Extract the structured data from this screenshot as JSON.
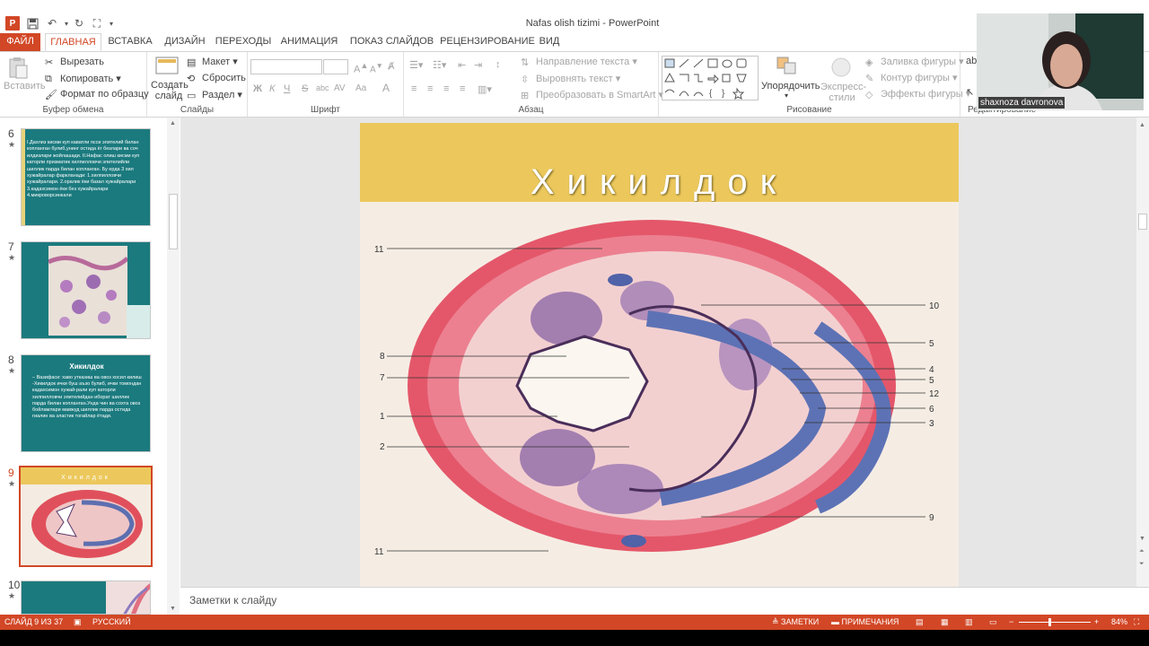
{
  "window": {
    "title": "Nafas olish tizimi - PowerPoint"
  },
  "tabs": [
    "ФАЙЛ",
    "ГЛАВНАЯ",
    "ВСТАВКА",
    "ДИЗАЙН",
    "ПЕРЕХОДЫ",
    "АНИМАЦИЯ",
    "ПОКАЗ СЛАЙДОВ",
    "РЕЦЕНЗИРОВАНИЕ",
    "ВИД"
  ],
  "ribbon": {
    "clipboard": {
      "paste": "Вставить",
      "cut": "Вырезать",
      "copy": "Копировать",
      "format_painter": "Формат по образцу",
      "label": "Буфер обмена"
    },
    "slides": {
      "new_slide": "Создать слайд",
      "layout": "Макет",
      "reset": "Сбросить",
      "section": "Раздел",
      "label": "Слайды"
    },
    "font": {
      "label": "Шрифт",
      "bold": "Ж",
      "italic": "К",
      "underline": "Ч",
      "strike": "S",
      "shadow": "abc",
      "spacing": "AV",
      "case": "Aa",
      "color": "A"
    },
    "paragraph": {
      "text_direction": "Направление текста",
      "align_text": "Выровнять текст",
      "smartart": "Преобразовать в SmartArt",
      "label": "Абзац"
    },
    "drawing": {
      "arrange": "Упорядочить",
      "quick_styles": "Экспресс-стили",
      "fill": "Заливка фигуры",
      "outline": "Контур фигуры",
      "effects": "Эффекты фигуры",
      "label": "Рисование"
    },
    "editing": {
      "label": "Редактирование"
    }
  },
  "thumbnails": [
    {
      "num": "6",
      "text": "I.Дахлиз кисми куп каватли ясси эпителий билан копланган булиб,унинг остида ёг безлари ва соч илдизлари жойлашади. II.Нафас олиш кисми куп каторли призматик хилпилловчи эпителийли шиллик парда билан копланган. Бу ерда 3 хил хужайралар фаркланади: 1.хилпилловчи хужайралари. 2.оралик ёки базал хужайралари 3.кадахсимон ёки без хужайралари 4.микроворсинкали"
    },
    {
      "num": "7",
      "text": ""
    },
    {
      "num": "8",
      "title": "Хикилдок",
      "text": "– Вазифаси: хаво утказиш ва овоз хосил килиш -Хикилдок ички буш аъзо булиб, ички томондан кадахсимон хужай-рали куп каторли хилпилловчи эпителийдан иборат шиллик парда билан копланган.Унда чин ва сохта овоз бойламлари мавжуд шиллик парда остида гиалин ва эластик тогайлар ётади."
    },
    {
      "num": "9",
      "title": "Хикилдок"
    },
    {
      "num": "10",
      "text": ""
    }
  ],
  "slide": {
    "title": "Хикилдок",
    "labels": [
      "11",
      "8",
      "7",
      "1",
      "2",
      "11",
      "10",
      "5",
      "4",
      "5",
      "12",
      "6",
      "3",
      "9"
    ]
  },
  "notes_placeholder": "Заметки к слайду",
  "statusbar": {
    "slide_info": "СЛАЙД 9 ИЗ 37",
    "language": "РУССКИЙ",
    "notes": "ЗАМЕТКИ",
    "comments": "ПРИМЕЧАНИЯ",
    "zoom": "84%"
  },
  "webcam": {
    "name": "shaxnoza davronova"
  },
  "colors": {
    "accent": "#d24726",
    "title_band": "#ecc85c",
    "thumb_teal": "#1b7a7e"
  }
}
